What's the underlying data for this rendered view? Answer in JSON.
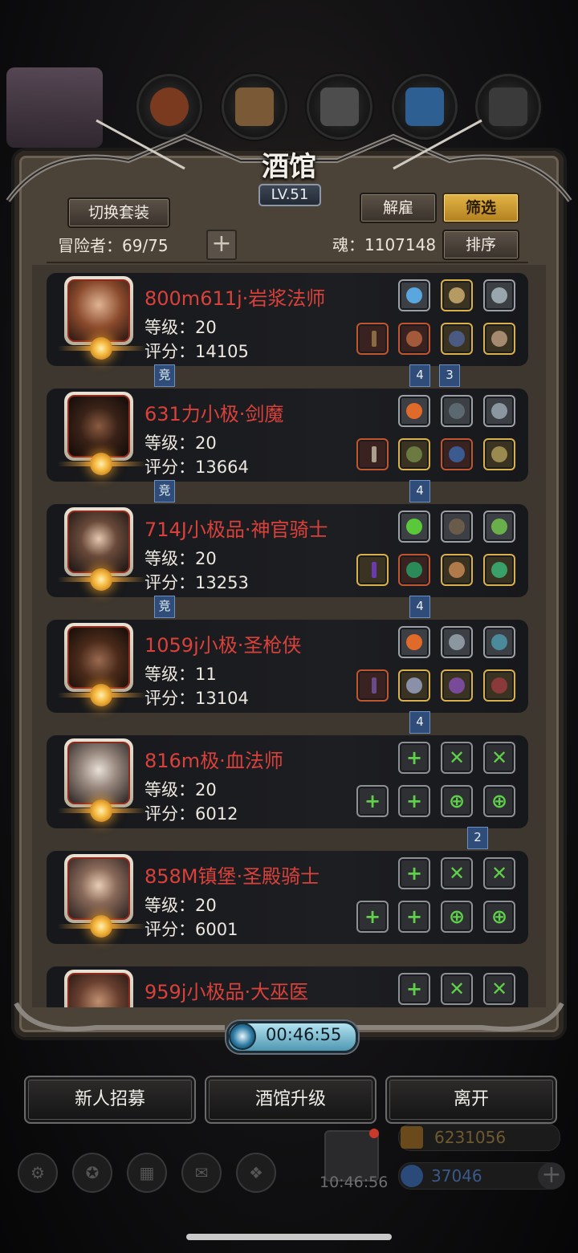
{
  "title": "酒馆",
  "level": "LV.51",
  "buttons": {
    "switch_outfit": "切换套装",
    "dismiss": "解雇",
    "filter": "筛选",
    "sort": "排序",
    "add": "+"
  },
  "header": {
    "adventurers": "冒险者：69/75",
    "soul": "魂：1107148"
  },
  "heroes": [
    {
      "name": "800m611j·岩浆法师",
      "level": "等级：20",
      "score": "评分：14105"
    },
    {
      "name": "631力小极·剑魔",
      "level": "等级：20",
      "score": "评分：13664"
    },
    {
      "name": "714J小极品·神官骑士",
      "level": "等级：20",
      "score": "评分：13253"
    },
    {
      "name": "1059j小极·圣枪侠",
      "level": "等级：11",
      "score": "评分：13104"
    },
    {
      "name": "816m极·血法师",
      "level": "等级：20",
      "score": "评分：6012"
    },
    {
      "name": "858M镇堡·圣殿骑士",
      "level": "等级：20",
      "score": "评分：6001"
    },
    {
      "name": "959j小极品·大巫医",
      "level": "",
      "score": ""
    }
  ],
  "tags": {
    "compete": "竞",
    "t1a": "4",
    "t1b": "3",
    "t2": "4",
    "t3": "4",
    "t4": "4",
    "t5": "2"
  },
  "timer": "00:46:55",
  "bottom": {
    "recruit": "新人招募",
    "upgrade": "酒馆升级",
    "leave": "离开"
  },
  "hud": {
    "gold": "6231056",
    "gems": "37046",
    "clock": "10:46:56",
    "plus": "+"
  },
  "colors": {
    "hero_name": "#d9413a",
    "filter_active": "#e3b547"
  }
}
